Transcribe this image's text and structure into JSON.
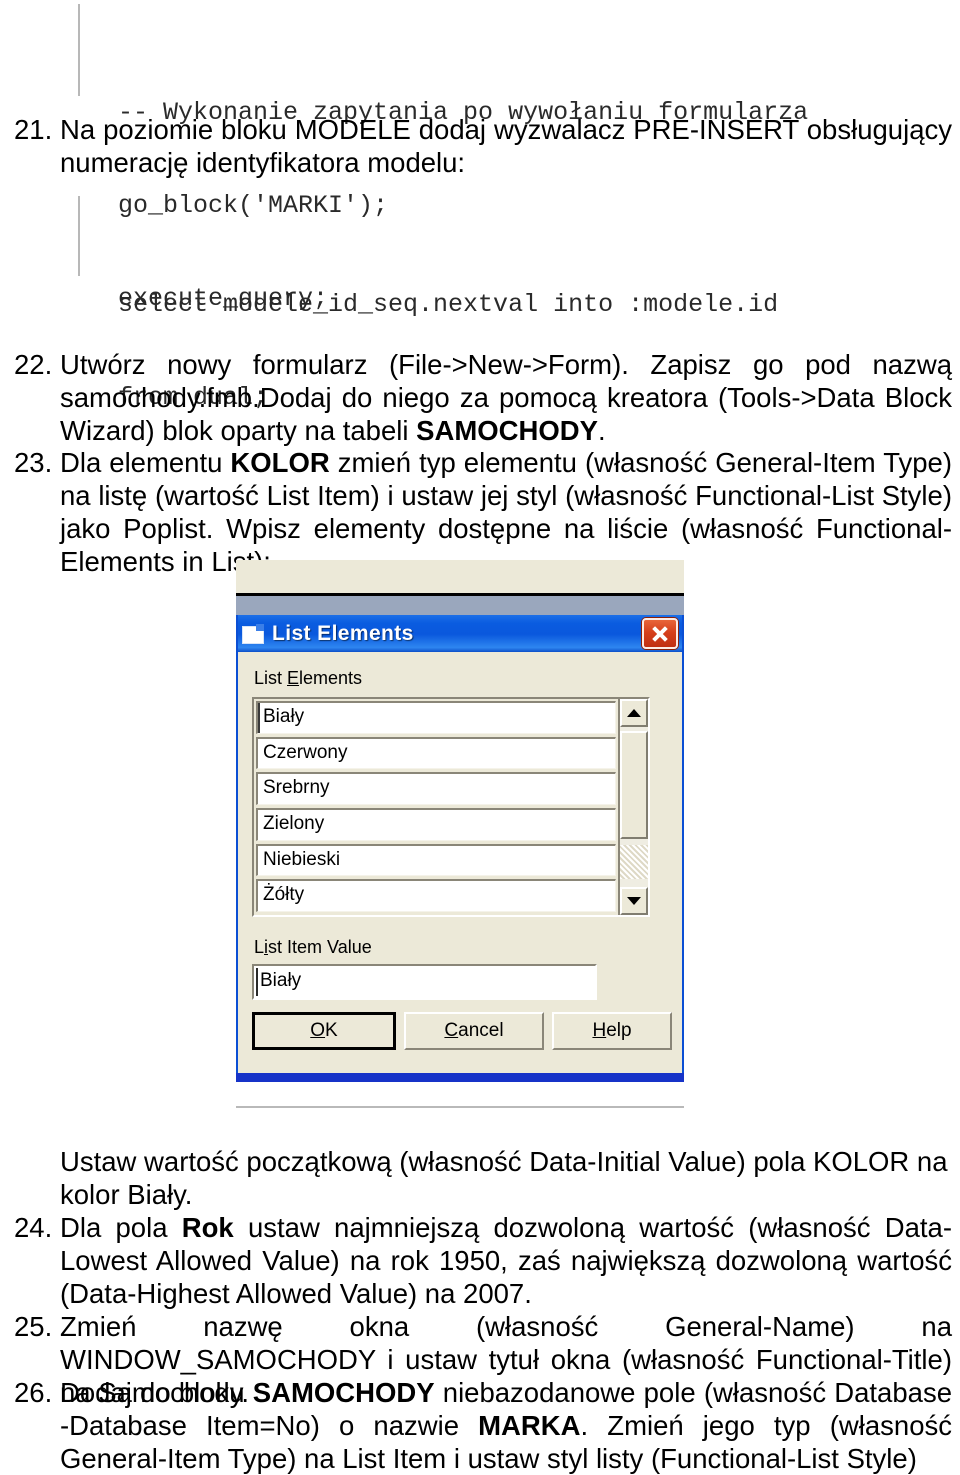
{
  "document": {
    "code_block_1": [
      "-- Wykonanie zapytania po wywołaniu formularza",
      "go_block('MARKI');",
      "execute_query;"
    ],
    "code_block_2": [
      "select modele_id_seq.nextval into :modele.id",
      "from dual;"
    ],
    "items": [
      {
        "number": "21.",
        "text": "Na poziomie bloku MODELE dodaj wyzwalacz PRE-INSERT obsługujący numerację identyfikatora modelu:"
      },
      {
        "number": "22.",
        "text_pre": "Utwórz nowy formularz (File->New->Form). Zapisz go pod nazwą samochody.fmb.Dodaj do niego za pomocą kreatora (Tools->Data Block Wizard) blok oparty na tabeli ",
        "bold": "SAMOCHODY",
        "text_post": "."
      },
      {
        "number": "23.",
        "text_pre": "Dla elementu ",
        "bold": "KOLOR",
        "text_post": " zmień typ elementu (własność General-Item Type) na listę (wartość List Item) i ustaw jej styl (własność Functional-List Style) jako Poplist. Wpisz elementy dostępne na liście (własność Functional-Elements in List):"
      },
      {
        "number": "24.",
        "text_pre": "Dla pola ",
        "bold": "Rok",
        "text_post": " ustaw najmniejszą dozwoloną wartość (własność Data-Lowest Allowed Value) na rok 1950, zaś największą dozwoloną wartość (Data-Highest Allowed Value) na 2007."
      },
      {
        "number": "25.",
        "text": "Zmień nazwę okna (własność General-Name) na WINDOW_SAMOCHODY i ustaw tytuł okna (własność Functional-Title) na Samochody."
      },
      {
        "number": "26.",
        "text_pre": "Dodaj do bloku ",
        "bold": "SAMOCHODY",
        "text_mid": " niebazodanowe pole (własność Database -Database Item=No) o nazwie ",
        "bold2": "MARKA",
        "text_post": ". Zmień jego typ (własność General-Item Type) na List Item i ustaw styl listy (Functional-List Style)"
      }
    ],
    "paragraph_initial_value": {
      "line1": "Ustaw wartość początkową (własność Data-Initial Value) pola KOLOR na",
      "line2": "kolor Biały."
    }
  },
  "dialog": {
    "title": "List Elements",
    "close_icon": "close-icon",
    "window_icon": "window-icon",
    "list_label": {
      "pre": "List ",
      "accel": "E",
      "post": "lements"
    },
    "list_items": [
      "Biały",
      "Czerwony",
      "Srebrny",
      "Zielony",
      "Niebieski",
      "Żółty"
    ],
    "value_label": {
      "pre": "L",
      "accel": "i",
      "post": "st Item Value"
    },
    "value_field": "Biały",
    "buttons": [
      {
        "pre": "",
        "accel": "O",
        "post": "K",
        "name": "ok-button"
      },
      {
        "pre": "",
        "accel": "C",
        "post": "ancel",
        "name": "cancel-button"
      },
      {
        "pre": "",
        "accel": "H",
        "post": "elp",
        "name": "help-button"
      }
    ],
    "scroll_up_icon": "chevron-up-icon",
    "scroll_down_icon": "chevron-down-icon",
    "colors": {
      "titlebar": "#0a58dd",
      "face": "#ece9d8",
      "close": "#d6401c",
      "bottom_bar": "#1633c8"
    }
  }
}
